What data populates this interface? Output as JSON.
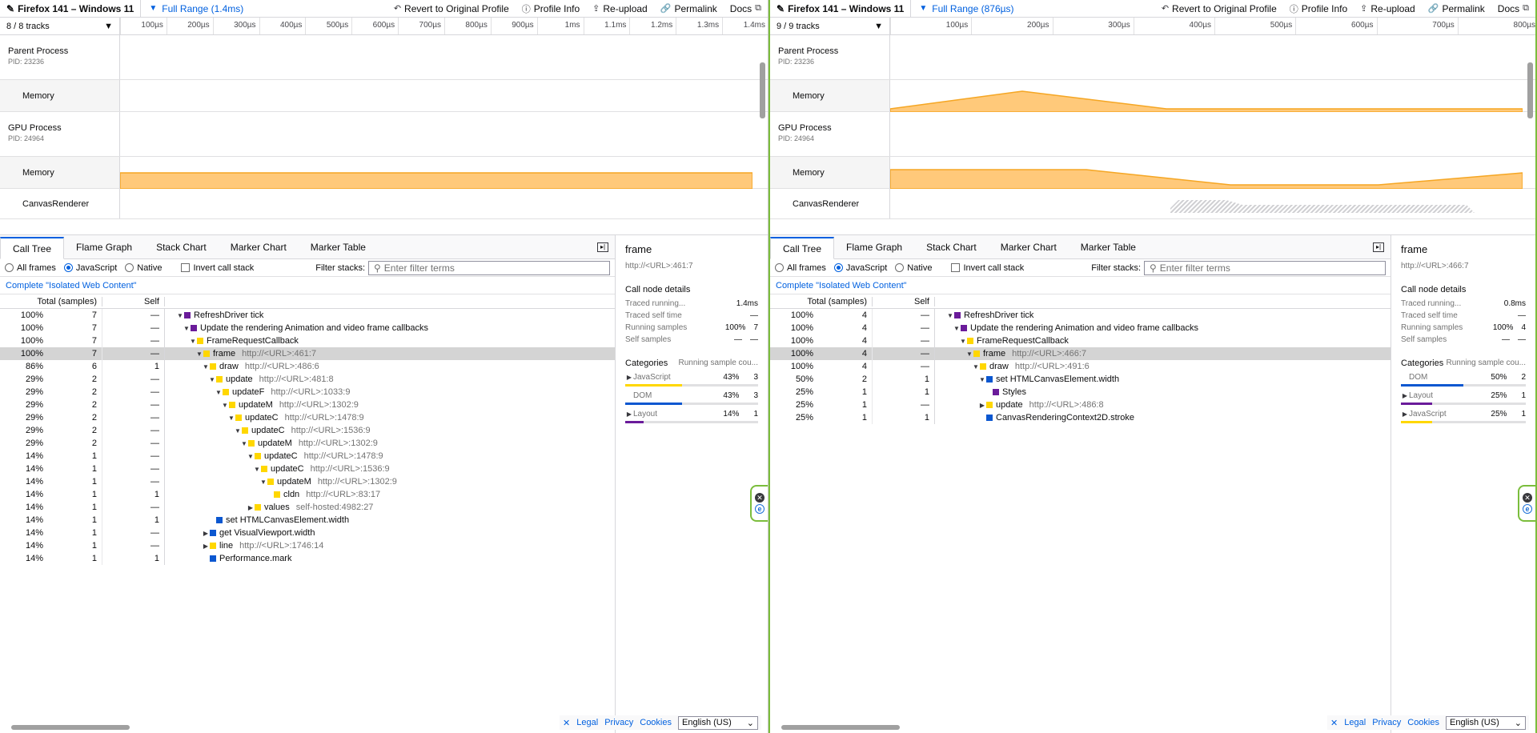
{
  "colors": {
    "js": "#ffd700",
    "dom": "#0b57d0",
    "layout": "#6a1b9a",
    "refresh": "#6a1b9a",
    "memory": "#f5a623"
  },
  "left": {
    "title": "Firefox 141 – Windows 11",
    "range": "Full Range (1.4ms)",
    "buttons": {
      "revert": "Revert to Original Profile",
      "info": "Profile Info",
      "reupload": "Re-upload",
      "permalink": "Permalink",
      "docs": "Docs"
    },
    "track_count": "8 / 8 tracks",
    "ticks": [
      "100µs",
      "200µs",
      "300µs",
      "400µs",
      "500µs",
      "600µs",
      "700µs",
      "800µs",
      "900µs",
      "1ms",
      "1.1ms",
      "1.2ms",
      "1.3ms",
      "1.4ms"
    ],
    "tracks": {
      "parent": "Parent Process",
      "parent_pid": "PID: 23236",
      "mem1": "Memory",
      "gpu": "GPU Process",
      "gpu_pid": "PID: 24964",
      "mem2": "Memory",
      "canvas": "CanvasRenderer"
    },
    "tabs": [
      "Call Tree",
      "Flame Graph",
      "Stack Chart",
      "Marker Chart",
      "Marker Table"
    ],
    "settings": {
      "all": "All frames",
      "js": "JavaScript",
      "native": "Native",
      "invert": "Invert call stack",
      "filter_label": "Filter stacks:",
      "filter_placeholder": "Enter filter terms"
    },
    "breadcrumb": "Complete \"Isolated Web Content\"",
    "headers": {
      "total": "Total (samples)",
      "self": "Self"
    },
    "rows": [
      {
        "pct": "100%",
        "cnt": "7",
        "self": "—",
        "depth": 0,
        "tw": "▼",
        "col": "#6a1b9a",
        "name": "RefreshDriver tick",
        "url": ""
      },
      {
        "pct": "100%",
        "cnt": "7",
        "self": "—",
        "depth": 1,
        "tw": "▼",
        "col": "#6a1b9a",
        "name": "Update the rendering Animation and video frame callbacks",
        "url": ""
      },
      {
        "pct": "100%",
        "cnt": "7",
        "self": "—",
        "depth": 2,
        "tw": "▼",
        "col": "#ffd700",
        "name": "FrameRequestCallback",
        "url": ""
      },
      {
        "pct": "100%",
        "cnt": "7",
        "self": "—",
        "depth": 3,
        "tw": "▼",
        "col": "#ffd700",
        "name": "frame",
        "url": "http://<URL>:461:7",
        "sel": true
      },
      {
        "pct": "86%",
        "cnt": "6",
        "self": "1",
        "depth": 4,
        "tw": "▼",
        "col": "#ffd700",
        "name": "draw",
        "url": "http://<URL>:486:6"
      },
      {
        "pct": "29%",
        "cnt": "2",
        "self": "—",
        "depth": 5,
        "tw": "▼",
        "col": "#ffd700",
        "name": "update",
        "url": "http://<URL>:481:8"
      },
      {
        "pct": "29%",
        "cnt": "2",
        "self": "—",
        "depth": 6,
        "tw": "▼",
        "col": "#ffd700",
        "name": "updateF",
        "url": "http://<URL>:1033:9"
      },
      {
        "pct": "29%",
        "cnt": "2",
        "self": "—",
        "depth": 7,
        "tw": "▼",
        "col": "#ffd700",
        "name": "updateM",
        "url": "http://<URL>:1302:9"
      },
      {
        "pct": "29%",
        "cnt": "2",
        "self": "—",
        "depth": 8,
        "tw": "▼",
        "col": "#ffd700",
        "name": "updateC",
        "url": "http://<URL>:1478:9"
      },
      {
        "pct": "29%",
        "cnt": "2",
        "self": "—",
        "depth": 9,
        "tw": "▼",
        "col": "#ffd700",
        "name": "updateC",
        "url": "http://<URL>:1536:9"
      },
      {
        "pct": "29%",
        "cnt": "2",
        "self": "—",
        "depth": 10,
        "tw": "▼",
        "col": "#ffd700",
        "name": "updateM",
        "url": "http://<URL>:1302:9"
      },
      {
        "pct": "14%",
        "cnt": "1",
        "self": "—",
        "depth": 11,
        "tw": "▼",
        "col": "#ffd700",
        "name": "updateC",
        "url": "http://<URL>:1478:9"
      },
      {
        "pct": "14%",
        "cnt": "1",
        "self": "—",
        "depth": 12,
        "tw": "▼",
        "col": "#ffd700",
        "name": "updateC",
        "url": "http://<URL>:1536:9"
      },
      {
        "pct": "14%",
        "cnt": "1",
        "self": "—",
        "depth": 13,
        "tw": "▼",
        "col": "#ffd700",
        "name": "updateM",
        "url": "http://<URL>:1302:9"
      },
      {
        "pct": "14%",
        "cnt": "1",
        "self": "1",
        "depth": 14,
        "tw": "",
        "col": "#ffd700",
        "name": "cldn",
        "url": "http://<URL>:83:17"
      },
      {
        "pct": "14%",
        "cnt": "1",
        "self": "—",
        "depth": 11,
        "tw": "▶",
        "col": "#ffd700",
        "name": "values",
        "url": "self-hosted:4982:27"
      },
      {
        "pct": "14%",
        "cnt": "1",
        "self": "1",
        "depth": 5,
        "tw": "",
        "col": "#0b57d0",
        "name": "set HTMLCanvasElement.width",
        "url": ""
      },
      {
        "pct": "14%",
        "cnt": "1",
        "self": "—",
        "depth": 4,
        "tw": "▶",
        "col": "#0b57d0",
        "name": "get VisualViewport.width",
        "url": ""
      },
      {
        "pct": "14%",
        "cnt": "1",
        "self": "—",
        "depth": 4,
        "tw": "▶",
        "col": "#ffd700",
        "name": "line",
        "url": "http://<URL>:1746:14"
      },
      {
        "pct": "14%",
        "cnt": "1",
        "self": "1",
        "depth": 4,
        "tw": "",
        "col": "#0b57d0",
        "name": "Performance.mark",
        "url": ""
      }
    ],
    "sidebar": {
      "title": "frame",
      "url": "http://<URL>:461:7",
      "details": "Call node details",
      "items": [
        {
          "k": "Traced running...",
          "a": "",
          "b": "1.4ms"
        },
        {
          "k": "Traced self time",
          "a": "",
          "b": "—"
        },
        {
          "k": "Running samples",
          "a": "100%",
          "b": "7"
        },
        {
          "k": "Self samples",
          "a": "—",
          "b": "—"
        }
      ],
      "categories_label": "Categories",
      "categories_note": "Running sample cou...",
      "cats": [
        {
          "tw": "▶",
          "name": "JavaScript",
          "pct": "43%",
          "n": "3",
          "fill": 0.43,
          "col": "#ffd700"
        },
        {
          "tw": "",
          "name": "DOM",
          "pct": "43%",
          "n": "3",
          "fill": 0.43,
          "col": "#0b57d0"
        },
        {
          "tw": "▶",
          "name": "Layout",
          "pct": "14%",
          "n": "1",
          "fill": 0.14,
          "col": "#6a1b9a"
        }
      ]
    },
    "footer": {
      "legal": "Legal",
      "privacy": "Privacy",
      "cookies": "Cookies",
      "lang": "English (US)"
    }
  },
  "right": {
    "title": "Firefox 141 – Windows 11",
    "range": "Full Range (876µs)",
    "buttons": {
      "revert": "Revert to Original Profile",
      "info": "Profile Info",
      "reupload": "Re-upload",
      "permalink": "Permalink",
      "docs": "Docs"
    },
    "track_count": "9 / 9 tracks",
    "ticks": [
      "100µs",
      "200µs",
      "300µs",
      "400µs",
      "500µs",
      "600µs",
      "700µs",
      "800µs"
    ],
    "tracks": {
      "parent": "Parent Process",
      "parent_pid": "PID: 23236",
      "mem1": "Memory",
      "gpu": "GPU Process",
      "gpu_pid": "PID: 24964",
      "mem2": "Memory",
      "canvas": "CanvasRenderer"
    },
    "tabs": [
      "Call Tree",
      "Flame Graph",
      "Stack Chart",
      "Marker Chart",
      "Marker Table"
    ],
    "settings": {
      "all": "All frames",
      "js": "JavaScript",
      "native": "Native",
      "invert": "Invert call stack",
      "filter_label": "Filter stacks:",
      "filter_placeholder": "Enter filter terms"
    },
    "breadcrumb": "Complete \"Isolated Web Content\"",
    "headers": {
      "total": "Total (samples)",
      "self": "Self"
    },
    "rows": [
      {
        "pct": "100%",
        "cnt": "4",
        "self": "—",
        "depth": 0,
        "tw": "▼",
        "col": "#6a1b9a",
        "name": "RefreshDriver tick",
        "url": ""
      },
      {
        "pct": "100%",
        "cnt": "4",
        "self": "—",
        "depth": 1,
        "tw": "▼",
        "col": "#6a1b9a",
        "name": "Update the rendering Animation and video frame callbacks",
        "url": ""
      },
      {
        "pct": "100%",
        "cnt": "4",
        "self": "—",
        "depth": 2,
        "tw": "▼",
        "col": "#ffd700",
        "name": "FrameRequestCallback",
        "url": ""
      },
      {
        "pct": "100%",
        "cnt": "4",
        "self": "—",
        "depth": 3,
        "tw": "▼",
        "col": "#ffd700",
        "name": "frame",
        "url": "http://<URL>:466:7",
        "sel": true
      },
      {
        "pct": "100%",
        "cnt": "4",
        "self": "—",
        "depth": 4,
        "tw": "▼",
        "col": "#ffd700",
        "name": "draw",
        "url": "http://<URL>:491:6"
      },
      {
        "pct": "50%",
        "cnt": "2",
        "self": "1",
        "depth": 5,
        "tw": "▼",
        "col": "#0b57d0",
        "name": "set HTMLCanvasElement.width",
        "url": ""
      },
      {
        "pct": "25%",
        "cnt": "1",
        "self": "1",
        "depth": 6,
        "tw": "",
        "col": "#6a1b9a",
        "name": "Styles",
        "url": ""
      },
      {
        "pct": "25%",
        "cnt": "1",
        "self": "—",
        "depth": 5,
        "tw": "▶",
        "col": "#ffd700",
        "name": "update",
        "url": "http://<URL>:486:8"
      },
      {
        "pct": "25%",
        "cnt": "1",
        "self": "1",
        "depth": 5,
        "tw": "",
        "col": "#0b57d0",
        "name": "CanvasRenderingContext2D.stroke",
        "url": ""
      }
    ],
    "sidebar": {
      "title": "frame",
      "url": "http://<URL>:466:7",
      "details": "Call node details",
      "items": [
        {
          "k": "Traced running...",
          "a": "",
          "b": "0.8ms"
        },
        {
          "k": "Traced self time",
          "a": "",
          "b": "—"
        },
        {
          "k": "Running samples",
          "a": "100%",
          "b": "4"
        },
        {
          "k": "Self samples",
          "a": "—",
          "b": "—"
        }
      ],
      "categories_label": "Categories",
      "categories_note": "Running sample cou...",
      "cats": [
        {
          "tw": "",
          "name": "DOM",
          "pct": "50%",
          "n": "2",
          "fill": 0.5,
          "col": "#0b57d0"
        },
        {
          "tw": "▶",
          "name": "Layout",
          "pct": "25%",
          "n": "1",
          "fill": 0.25,
          "col": "#6a1b9a"
        },
        {
          "tw": "▶",
          "name": "JavaScript",
          "pct": "25%",
          "n": "1",
          "fill": 0.25,
          "col": "#ffd700"
        }
      ]
    },
    "footer": {
      "legal": "Legal",
      "privacy": "Privacy",
      "cookies": "Cookies",
      "lang": "English (US)"
    }
  }
}
